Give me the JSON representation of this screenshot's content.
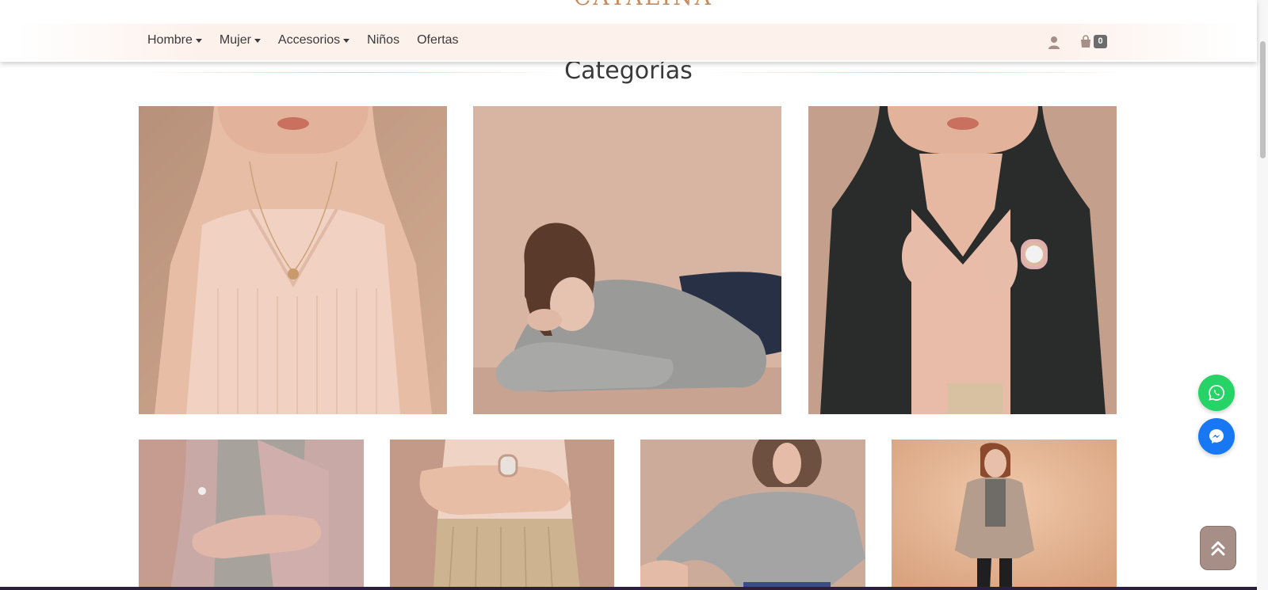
{
  "header": {
    "logo_text": "CATALINA",
    "nav": [
      {
        "label": "Hombre",
        "dropdown": true
      },
      {
        "label": "Mujer",
        "dropdown": true
      },
      {
        "label": "Accesorios",
        "dropdown": true
      },
      {
        "label": "Niños",
        "dropdown": false
      },
      {
        "label": "Ofertas",
        "dropdown": false
      }
    ],
    "user_icon": "user-icon",
    "cart": {
      "icon": "shopping-bag-icon",
      "count": "0"
    }
  },
  "section": {
    "title": "Categorías"
  },
  "floating": {
    "whatsapp_icon": "whatsapp-icon",
    "messenger_icon": "messenger-icon",
    "back_to_top_icon": "double-chevron-up-icon"
  },
  "colors": {
    "accent": "#c58a5e",
    "nav_band": "#fdf1ec",
    "whatsapp": "#25d366",
    "messenger": "#1877f2",
    "back_to_top": "#a78f88"
  }
}
